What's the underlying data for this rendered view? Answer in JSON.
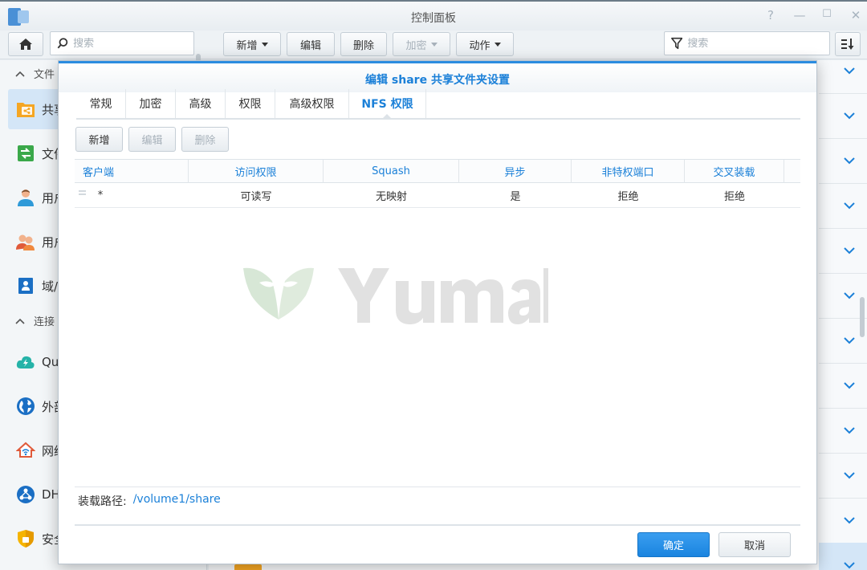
{
  "window": {
    "title": "控制面板",
    "controls": [
      "?",
      "—",
      "☐",
      "✕"
    ]
  },
  "toolbar": {
    "search_placeholder": "搜索",
    "buttons": [
      {
        "label": "新增",
        "dropdown": true,
        "disabled": false
      },
      {
        "label": "编辑",
        "dropdown": false,
        "disabled": false
      },
      {
        "label": "删除",
        "dropdown": false,
        "disabled": false
      },
      {
        "label": "加密",
        "dropdown": true,
        "disabled": true
      },
      {
        "label": "动作",
        "dropdown": true,
        "disabled": false
      }
    ],
    "filter_placeholder": "搜索"
  },
  "sidebar": {
    "sections": [
      {
        "label": "文件"
      },
      {
        "label": "连接"
      }
    ],
    "items": [
      {
        "label": "共享",
        "icon": "shared-folder-icon",
        "active": true
      },
      {
        "label": "文件",
        "icon": "file-services-icon",
        "active": false
      },
      {
        "label": "用户",
        "icon": "user-icon",
        "active": false
      },
      {
        "label": "用户",
        "icon": "group-icon",
        "active": false
      },
      {
        "label": "域/",
        "icon": "domain-icon",
        "active": false
      },
      {
        "label": "Qu",
        "icon": "quickconnect-icon",
        "active": false
      },
      {
        "label": "外部",
        "icon": "external-access-icon",
        "active": false
      },
      {
        "label": "网络",
        "icon": "network-icon",
        "active": false
      },
      {
        "label": "DH",
        "icon": "dhcp-icon",
        "active": false
      },
      {
        "label": "安全",
        "icon": "security-icon",
        "active": false
      }
    ]
  },
  "dialog": {
    "title": "编辑 share 共享文件夹设置",
    "tabs": [
      {
        "label": "常规",
        "active": false
      },
      {
        "label": "加密",
        "active": false
      },
      {
        "label": "高级",
        "active": false
      },
      {
        "label": "权限",
        "active": false
      },
      {
        "label": "高级权限",
        "active": false
      },
      {
        "label": "NFS 权限",
        "active": true
      }
    ],
    "actions": [
      {
        "label": "新增",
        "disabled": false
      },
      {
        "label": "编辑",
        "disabled": true
      },
      {
        "label": "删除",
        "disabled": true
      }
    ],
    "table": {
      "columns": [
        "客户端",
        "访问权限",
        "Squash",
        "异步",
        "非特权端口",
        "交叉装载"
      ],
      "rows": [
        {
          "client": "*",
          "access": "可读写",
          "squash": "无映射",
          "async": "是",
          "nonpriv_port": "拒绝",
          "cross_mount": "拒绝"
        }
      ]
    },
    "mount_path_label": "装载路径:",
    "mount_path_value": "/volume1/share",
    "ok_label": "确定",
    "cancel_label": "取消"
  },
  "colors": {
    "accent": "#1b80d8",
    "primary_button": "#1a84df",
    "active_sidebar": "#d4e6f7"
  }
}
